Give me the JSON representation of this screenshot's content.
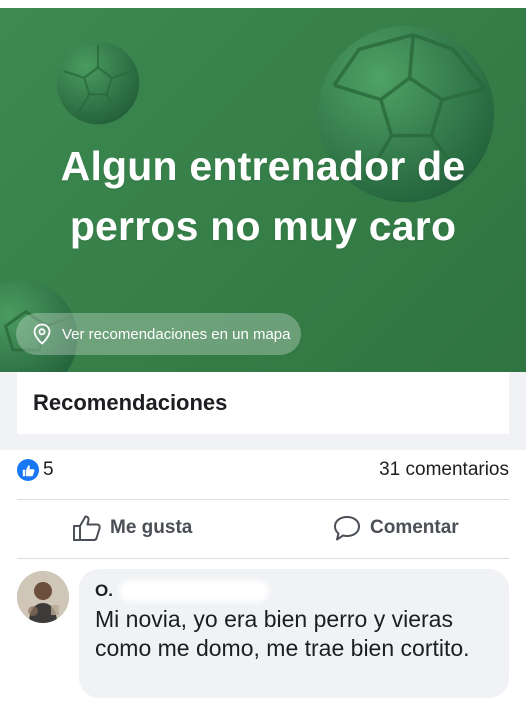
{
  "banner": {
    "title": "Algun entrenador de perros no muy caro",
    "map_button_label": "Ver recomendaciones en un mapa",
    "background_color": "#378049"
  },
  "section": {
    "title": "Recomendaciones"
  },
  "reactions": {
    "like_count": "5",
    "comments_label": "31 comentarios",
    "like_color": "#1877f2"
  },
  "actions": {
    "like_label": "Me gusta",
    "comment_label": "Comentar"
  },
  "comment": {
    "author_initial": "O.",
    "text": "Mi novia, yo era bien perro y vieras como me domo, me trae bien cortito."
  }
}
